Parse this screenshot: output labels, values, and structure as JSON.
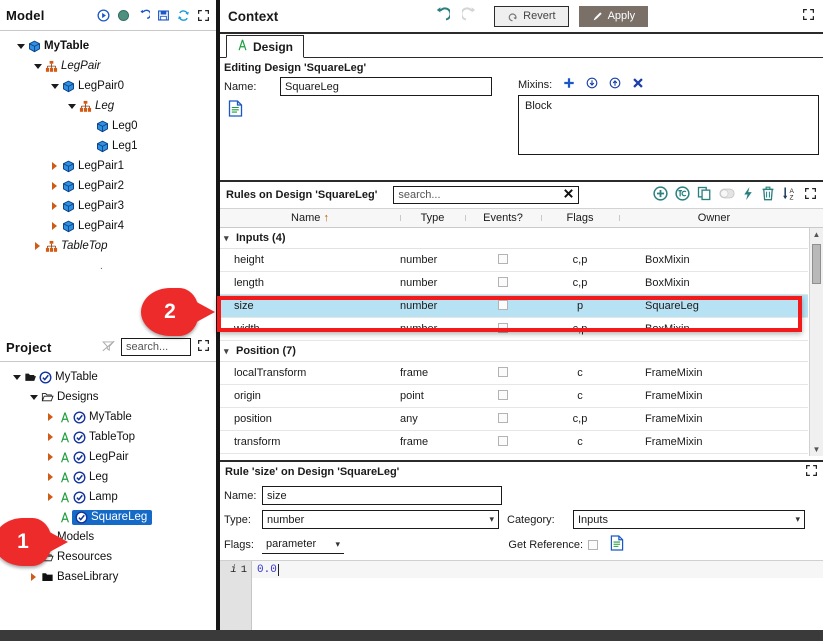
{
  "model_panel": {
    "title": "Model",
    "toolbar_icons": [
      "play-icon",
      "record-icon",
      "undo-icon",
      "save-icon",
      "refresh-icon",
      "expand-icon"
    ],
    "tree": [
      {
        "label": "MyTable",
        "indent": 0,
        "expander": "down",
        "icon": "cube-icon",
        "italic": false,
        "bold": true
      },
      {
        "label": "LegPair",
        "indent": 1,
        "expander": "down",
        "icon": "hierarchy-icon",
        "italic": true,
        "bold": false
      },
      {
        "label": "LegPair0",
        "indent": 2,
        "expander": "down",
        "icon": "cube-icon",
        "italic": false,
        "bold": false
      },
      {
        "label": "Leg",
        "indent": 3,
        "expander": "down",
        "icon": "hierarchy-icon",
        "italic": true,
        "bold": false
      },
      {
        "label": "Leg0",
        "indent": 4,
        "expander": "none",
        "icon": "cube-icon",
        "italic": false,
        "bold": false
      },
      {
        "label": "Leg1",
        "indent": 4,
        "expander": "none",
        "icon": "cube-icon",
        "italic": false,
        "bold": false
      },
      {
        "label": "LegPair1",
        "indent": 2,
        "expander": "right",
        "icon": "cube-icon",
        "italic": false,
        "bold": false
      },
      {
        "label": "LegPair2",
        "indent": 2,
        "expander": "right",
        "icon": "cube-icon",
        "italic": false,
        "bold": false
      },
      {
        "label": "LegPair3",
        "indent": 2,
        "expander": "right",
        "icon": "cube-icon",
        "italic": false,
        "bold": false
      },
      {
        "label": "LegPair4",
        "indent": 2,
        "expander": "right",
        "icon": "cube-icon",
        "italic": false,
        "bold": false
      },
      {
        "label": "TableTop",
        "indent": 1,
        "expander": "right",
        "icon": "hierarchy-icon",
        "italic": true,
        "bold": false
      }
    ]
  },
  "project_panel": {
    "title": "Project",
    "filter_icon": "filter-off-icon",
    "expand_icon": "expand-icon",
    "search": {
      "placeholder": "search...",
      "value": ""
    },
    "tree": [
      {
        "label": "MyTable",
        "indent": 0,
        "expander": "down",
        "icon": "folder-open-icon",
        "type_icon": "",
        "badge": "check-icon",
        "selected": false
      },
      {
        "label": "Designs",
        "indent": 1,
        "expander": "down",
        "icon": "folder-icon",
        "type_icon": "",
        "badge": "",
        "selected": false
      },
      {
        "label": "MyTable",
        "indent": 2,
        "expander": "right",
        "icon": "",
        "type_icon": "design-icon",
        "badge": "check-icon",
        "selected": false
      },
      {
        "label": "TableTop",
        "indent": 2,
        "expander": "right",
        "icon": "",
        "type_icon": "design-icon",
        "badge": "check-icon",
        "selected": false
      },
      {
        "label": "LegPair",
        "indent": 2,
        "expander": "right",
        "icon": "",
        "type_icon": "design-icon",
        "badge": "check-icon",
        "selected": false
      },
      {
        "label": "Leg",
        "indent": 2,
        "expander": "right",
        "icon": "",
        "type_icon": "design-icon",
        "badge": "check-icon",
        "selected": false
      },
      {
        "label": "Lamp",
        "indent": 2,
        "expander": "right",
        "icon": "",
        "type_icon": "design-icon",
        "badge": "check-icon",
        "selected": false
      },
      {
        "label": "SquareLeg",
        "indent": 2,
        "expander": "none",
        "icon": "",
        "type_icon": "design-icon",
        "badge": "check-icon",
        "selected": true
      },
      {
        "label": "Models",
        "indent": 1,
        "expander": "right",
        "icon": "folder-icon",
        "type_icon": "",
        "badge": "",
        "selected": false
      },
      {
        "label": "Resources",
        "indent": 1,
        "expander": "right",
        "icon": "folder-icon",
        "type_icon": "",
        "badge": "",
        "selected": false
      },
      {
        "label": "BaseLibrary",
        "indent": 1,
        "expander": "right",
        "icon": "folder-solid-icon",
        "type_icon": "",
        "badge": "",
        "selected": false
      }
    ]
  },
  "context": {
    "title": "Context",
    "undo_icon": "undo-icon",
    "redo_icon": "redo-icon",
    "revert_label": "Revert",
    "apply_label": "Apply",
    "expand_icon": "expand-icon",
    "tab": {
      "label": "Design",
      "icon": "design-icon"
    },
    "editing_label": "Editing Design 'SquareLeg'",
    "name_label": "Name:",
    "name_value": "SquareLeg",
    "doc_icon": "document-icon",
    "mixins_label": "Mixins:",
    "mixins_icons": [
      "plus-icon",
      "down-circle-icon",
      "up-circle-icon",
      "remove-x-icon"
    ],
    "mixins_items": [
      "Block"
    ]
  },
  "rules": {
    "title": "Rules on Design 'SquareLeg'",
    "search": {
      "placeholder": "search...",
      "value": "",
      "clear_icon": "clear-x-icon"
    },
    "toolbar_icons": [
      "add-rule-icon",
      "add-computed-rule-icon",
      "copy-icon",
      "toggle-icon",
      "bolt-icon",
      "delete-icon",
      "sort-az-icon",
      "expand-icon"
    ],
    "columns": [
      "Name",
      "Type",
      "Events?",
      "Flags",
      "Owner"
    ],
    "sort_indicator": "↑",
    "groups": [
      {
        "label": "Inputs (4)",
        "rows": [
          {
            "name": "height",
            "type": "number",
            "events": false,
            "flags": "c,p",
            "owner": "BoxMixin",
            "selected": false
          },
          {
            "name": "length",
            "type": "number",
            "events": false,
            "flags": "c,p",
            "owner": "BoxMixin",
            "selected": false
          },
          {
            "name": "size",
            "type": "number",
            "events": false,
            "flags": "p",
            "owner": "SquareLeg",
            "selected": true
          },
          {
            "name": "width",
            "type": "number",
            "events": false,
            "flags": "c,p",
            "owner": "BoxMixin",
            "selected": false
          }
        ]
      },
      {
        "label": "Position (7)",
        "rows": [
          {
            "name": "localTransform",
            "type": "frame",
            "events": false,
            "flags": "c",
            "owner": "FrameMixin",
            "selected": false
          },
          {
            "name": "origin",
            "type": "point",
            "events": false,
            "flags": "c",
            "owner": "FrameMixin",
            "selected": false
          },
          {
            "name": "position",
            "type": "any",
            "events": false,
            "flags": "c,p",
            "owner": "FrameMixin",
            "selected": false
          },
          {
            "name": "transform",
            "type": "frame",
            "events": false,
            "flags": "c",
            "owner": "FrameMixin",
            "selected": false
          }
        ]
      }
    ]
  },
  "rule_detail": {
    "title": "Rule 'size' on Design 'SquareLeg'",
    "expand_icon": "expand-icon",
    "name_label": "Name:",
    "name_value": "size",
    "type_label": "Type:",
    "type_value": "number",
    "category_label": "Category:",
    "category_value": "Inputs",
    "flags_label": "Flags:",
    "flags_value": "parameter",
    "get_reference_label": "Get Reference:",
    "get_reference_checked": false,
    "doc_icon": "document-icon",
    "code": {
      "info_icon": "i",
      "line_number": "1",
      "text": "0.0"
    }
  },
  "callouts": [
    {
      "number": "1",
      "target": "project-item-squareleg"
    },
    {
      "number": "2",
      "target": "rules-row-size"
    }
  ],
  "colors": {
    "selection_blue": "#1569c7",
    "row_highlight": "#b7e2f4",
    "callout_red": "#ee2b2b",
    "annotation_red": "#f21a1a",
    "apply_button": "#7a7068",
    "taskbar": "#3a3a3a",
    "taskbar_active": "#d2691e",
    "icon_teal": "#2a7f7f",
    "icon_blue": "#1a57c8",
    "icon_orange": "#cf5b15",
    "icon_green": "#1f9e3e"
  },
  "taskbar": {
    "active_item": true
  }
}
